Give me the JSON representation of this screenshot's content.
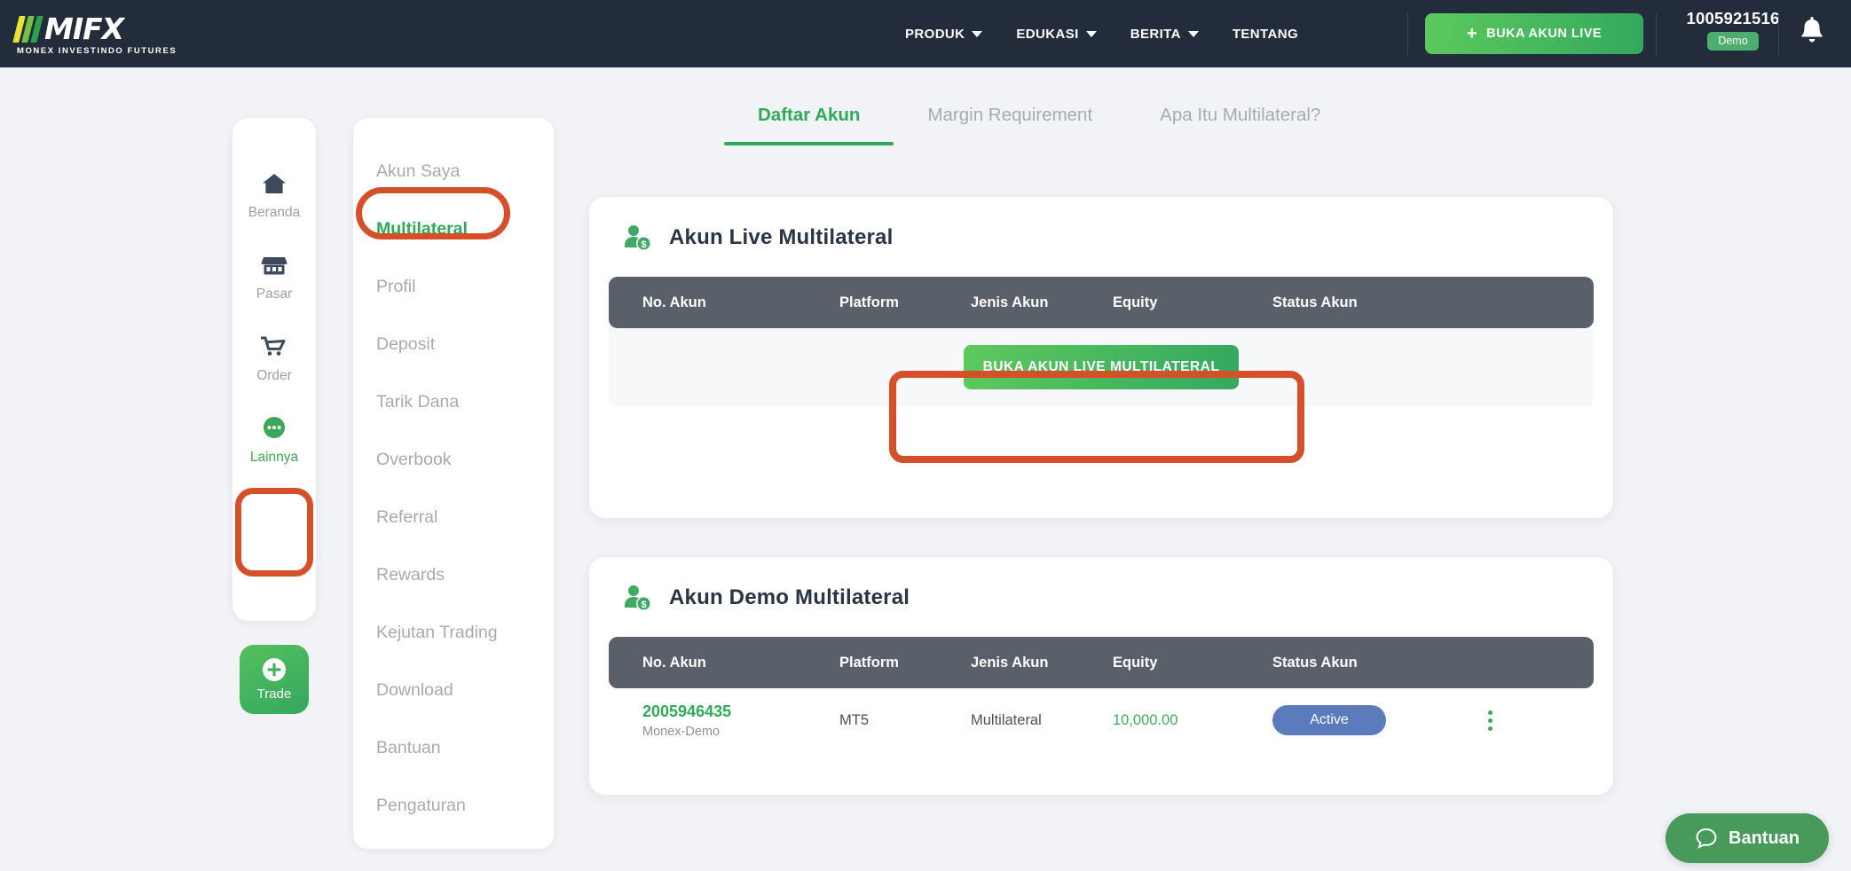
{
  "header": {
    "logo_text": "MIFX",
    "logo_sub": "MONEX INVESTINDO FUTURES",
    "nav": [
      {
        "label": "PRODUK",
        "has_caret": true
      },
      {
        "label": "EDUKASI",
        "has_caret": true
      },
      {
        "label": "BERITA",
        "has_caret": true
      },
      {
        "label": "TENTANG",
        "has_caret": false
      }
    ],
    "cta_label": "BUKA AKUN LIVE",
    "cta_plus": "+",
    "account_number": "1005921516",
    "account_badge": "Demo",
    "bell_icon": "bell-icon",
    "brand_dark": "#232c3b",
    "brand_green": "#3aa856"
  },
  "rail": {
    "items": [
      {
        "label": "Beranda",
        "icon": "home-icon",
        "active": false
      },
      {
        "label": "Pasar",
        "icon": "store-icon",
        "active": false
      },
      {
        "label": "Order",
        "icon": "cart-icon",
        "active": false
      },
      {
        "label": "Lainnya",
        "icon": "more-dots-icon",
        "active": true
      }
    ],
    "trade_label": "Trade",
    "trade_icon": "plus-circle-icon"
  },
  "menu": {
    "items": [
      {
        "label": "Akun Saya",
        "active": false
      },
      {
        "label": "Multilateral",
        "active": true
      },
      {
        "label": "Profil",
        "active": false
      },
      {
        "label": "Deposit",
        "active": false
      },
      {
        "label": "Tarik Dana",
        "active": false
      },
      {
        "label": "Overbook",
        "active": false
      },
      {
        "label": "Referral",
        "active": false
      },
      {
        "label": "Rewards",
        "active": false
      },
      {
        "label": "Kejutan Trading",
        "active": false
      },
      {
        "label": "Download",
        "active": false
      },
      {
        "label": "Bantuan",
        "active": false
      },
      {
        "label": "Pengaturan",
        "active": false
      }
    ]
  },
  "tabs": [
    {
      "label": "Daftar Akun",
      "active": true
    },
    {
      "label": "Margin Requirement",
      "active": false
    },
    {
      "label": "Apa Itu Multilateral?",
      "active": false
    }
  ],
  "live_card": {
    "title": "Akun Live Multilateral",
    "icon": "user-money-icon",
    "columns": [
      "No. Akun",
      "Platform",
      "Jenis Akun",
      "Equity",
      "Status Akun"
    ],
    "empty_button": "BUKA AKUN LIVE MULTILATERAL",
    "rows": []
  },
  "demo_card": {
    "title": "Akun Demo Multilateral",
    "icon": "user-money-icon",
    "columns": [
      "No. Akun",
      "Platform",
      "Jenis Akun",
      "Equity",
      "Status Akun"
    ],
    "rows": [
      {
        "account": "2005946435",
        "server": "Monex-Demo",
        "platform": "MT5",
        "type": "Multilateral",
        "equity": "10,000.00",
        "status": "Active"
      }
    ]
  },
  "help": {
    "label": "Bantuan",
    "icon": "chat-bubble-icon"
  },
  "highlights": {
    "color": "#d4502a",
    "targets": [
      "sidebar-item-lainnya",
      "menu-item-multilateral",
      "open-live-multilateral-button"
    ]
  }
}
